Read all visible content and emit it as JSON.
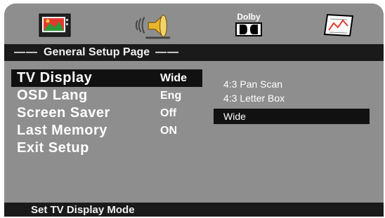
{
  "tabs": [
    {
      "icon": "tv-icon"
    },
    {
      "icon": "speaker-icon"
    },
    {
      "icon": "dolby-icon",
      "label": "Dolby"
    },
    {
      "icon": "preferences-icon"
    }
  ],
  "header": {
    "title": "General Setup Page",
    "dash_left": "——",
    "dash_right": "——"
  },
  "menu": {
    "items": [
      {
        "label": "TV Display",
        "value": "Wide"
      },
      {
        "label": "OSD Lang",
        "value": "Eng"
      },
      {
        "label": "Screen Saver",
        "value": "Off"
      },
      {
        "label": "Last Memory",
        "value": "ON"
      },
      {
        "label": "Exit Setup",
        "value": ""
      }
    ]
  },
  "options": {
    "items": [
      "4:3 Pan Scan",
      "4:3 Letter Box",
      "Wide"
    ]
  },
  "footer": {
    "help": "Set TV Display Mode"
  },
  "colors": {
    "panel": "#8e8e8e",
    "bar": "#1a1a1a",
    "highlight": "#111111",
    "text": "#ffffff"
  }
}
